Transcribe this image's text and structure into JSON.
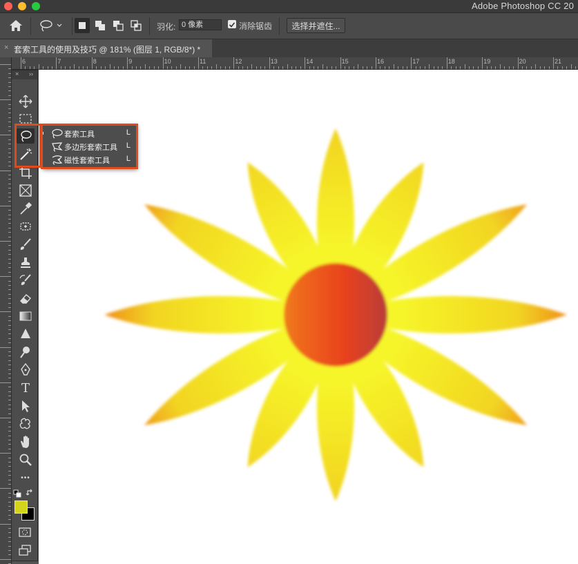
{
  "window": {
    "app_title": "Adobe Photoshop CC 20",
    "traffic_colors": [
      "#fe5f57",
      "#febc2e",
      "#28c840"
    ]
  },
  "options_bar": {
    "feather_label": "羽化:",
    "feather_value": "0 像素",
    "anti_alias_label": "消除锯齿",
    "anti_alias_checked": true,
    "select_and_mask_label": "选择并遮住..."
  },
  "document_tab": {
    "close_glyph": "×",
    "title": "套索工具的使用及技巧 @ 181% (图层 1, RGB/8*) *"
  },
  "ruler": {
    "numbers": [
      "6",
      "7",
      "8",
      "9",
      "10",
      "11",
      "12",
      "13",
      "14",
      "15",
      "16",
      "17",
      "18",
      "19",
      "20",
      "21"
    ]
  },
  "toolbar": {
    "header_close": "×",
    "header_collapse": "››",
    "tools": [
      {
        "name": "move-tool-icon"
      },
      {
        "name": "marquee-tool-icon"
      },
      {
        "name": "lasso-tool-icon"
      },
      {
        "name": "magic-wand-tool-icon"
      },
      {
        "name": "crop-tool-icon"
      },
      {
        "name": "frame-tool-icon"
      },
      {
        "name": "eyedropper-tool-icon"
      },
      {
        "name": "healing-brush-tool-icon"
      },
      {
        "name": "brush-tool-icon"
      },
      {
        "name": "clone-stamp-tool-icon"
      },
      {
        "name": "history-brush-tool-icon"
      },
      {
        "name": "eraser-tool-icon"
      },
      {
        "name": "gradient-tool-icon"
      },
      {
        "name": "blur-tool-icon"
      },
      {
        "name": "dodge-tool-icon"
      },
      {
        "name": "pen-tool-icon"
      },
      {
        "name": "type-tool-icon"
      },
      {
        "name": "path-selection-tool-icon"
      },
      {
        "name": "custom-shape-tool-icon"
      },
      {
        "name": "hand-tool-icon"
      },
      {
        "name": "zoom-tool-icon"
      },
      {
        "name": "more-tools-icon"
      }
    ],
    "type_tool_glyph": "T",
    "more_glyph": "•••",
    "foreground_color": "#d5d41d",
    "background_color": "#000000"
  },
  "lasso_flyout": {
    "items": [
      {
        "label": "套索工具",
        "shortcut": "L",
        "icon": "lasso-icon",
        "active": true
      },
      {
        "label": "多边形套索工具",
        "shortcut": "L",
        "icon": "polygonal-lasso-icon",
        "active": false
      },
      {
        "label": "磁性套索工具",
        "shortcut": "L",
        "icon": "magnetic-lasso-icon",
        "active": false
      }
    ],
    "highlight_color": "#e04a1d"
  },
  "canvas": {
    "background": "#ffffff",
    "artwork": "flower-shape",
    "gradient_colors": [
      "#f4f02a",
      "#e8421e",
      "#33318c"
    ]
  }
}
